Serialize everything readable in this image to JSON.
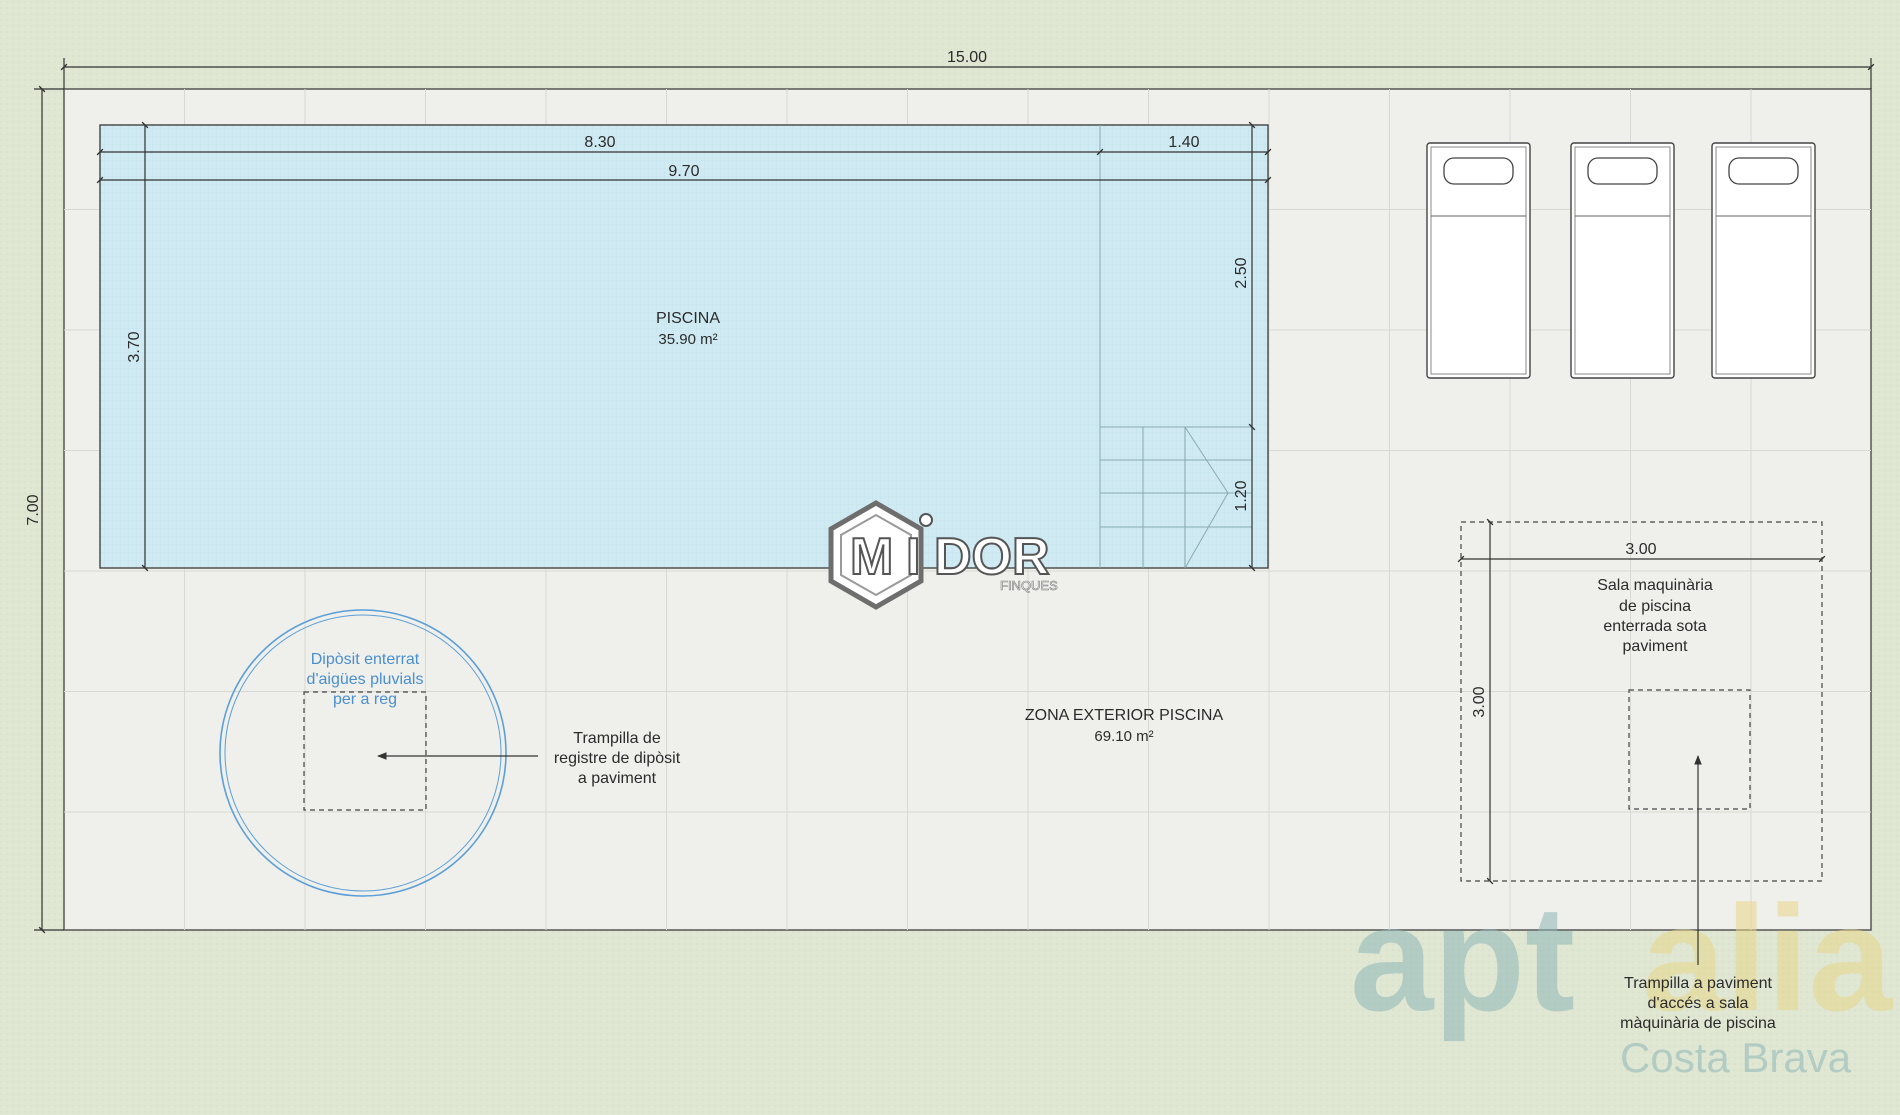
{
  "plan": {
    "overall_width": "15.00",
    "overall_height": "7.00",
    "colors": {
      "background": "#dfe6d2",
      "deck": "#efefeb",
      "pool_water": "#cfeaf2",
      "line": "#333333",
      "tank": "#5b9fd8",
      "brand_teal": "#8fb8b8",
      "brand_yellow": "#e8d68a"
    }
  },
  "pool": {
    "name": "PISCINA",
    "area": "35.90 m²",
    "dim_main_length": "8.30",
    "dim_steps_length": "1.40",
    "dim_total_length": "9.70",
    "dim_width": "3.70",
    "dim_upper_side": "2.50",
    "dim_steps_side": "1.20"
  },
  "exterior": {
    "name": "ZONA EXTERIOR PISCINA",
    "area": "69.10 m²"
  },
  "tank": {
    "label_lines": [
      "Dipòsit enterrat",
      "d'aigües pluvials",
      "per a reg"
    ],
    "hatch_label_lines": [
      "Trampilla de",
      "registre de dipòsit",
      "a paviment"
    ]
  },
  "machine_room": {
    "dim_width": "3.00",
    "dim_height": "3.00",
    "label_lines": [
      "Sala maquinària",
      "de piscina",
      "enterrada sota",
      "paviment"
    ],
    "hatch_label_lines": [
      "Trampilla a paviment",
      "d'accés a sala",
      "màquinària de piscina"
    ]
  },
  "loungers": {
    "count": 3
  },
  "watermarks": {
    "midor_prefix": "M",
    "midor_i": "I",
    "midor_suffix": "DOR",
    "midor_sub": "FINQUES",
    "aptalia_left": "apt",
    "aptalia_right": "alia",
    "aptalia_sub": "Costa Brava"
  }
}
